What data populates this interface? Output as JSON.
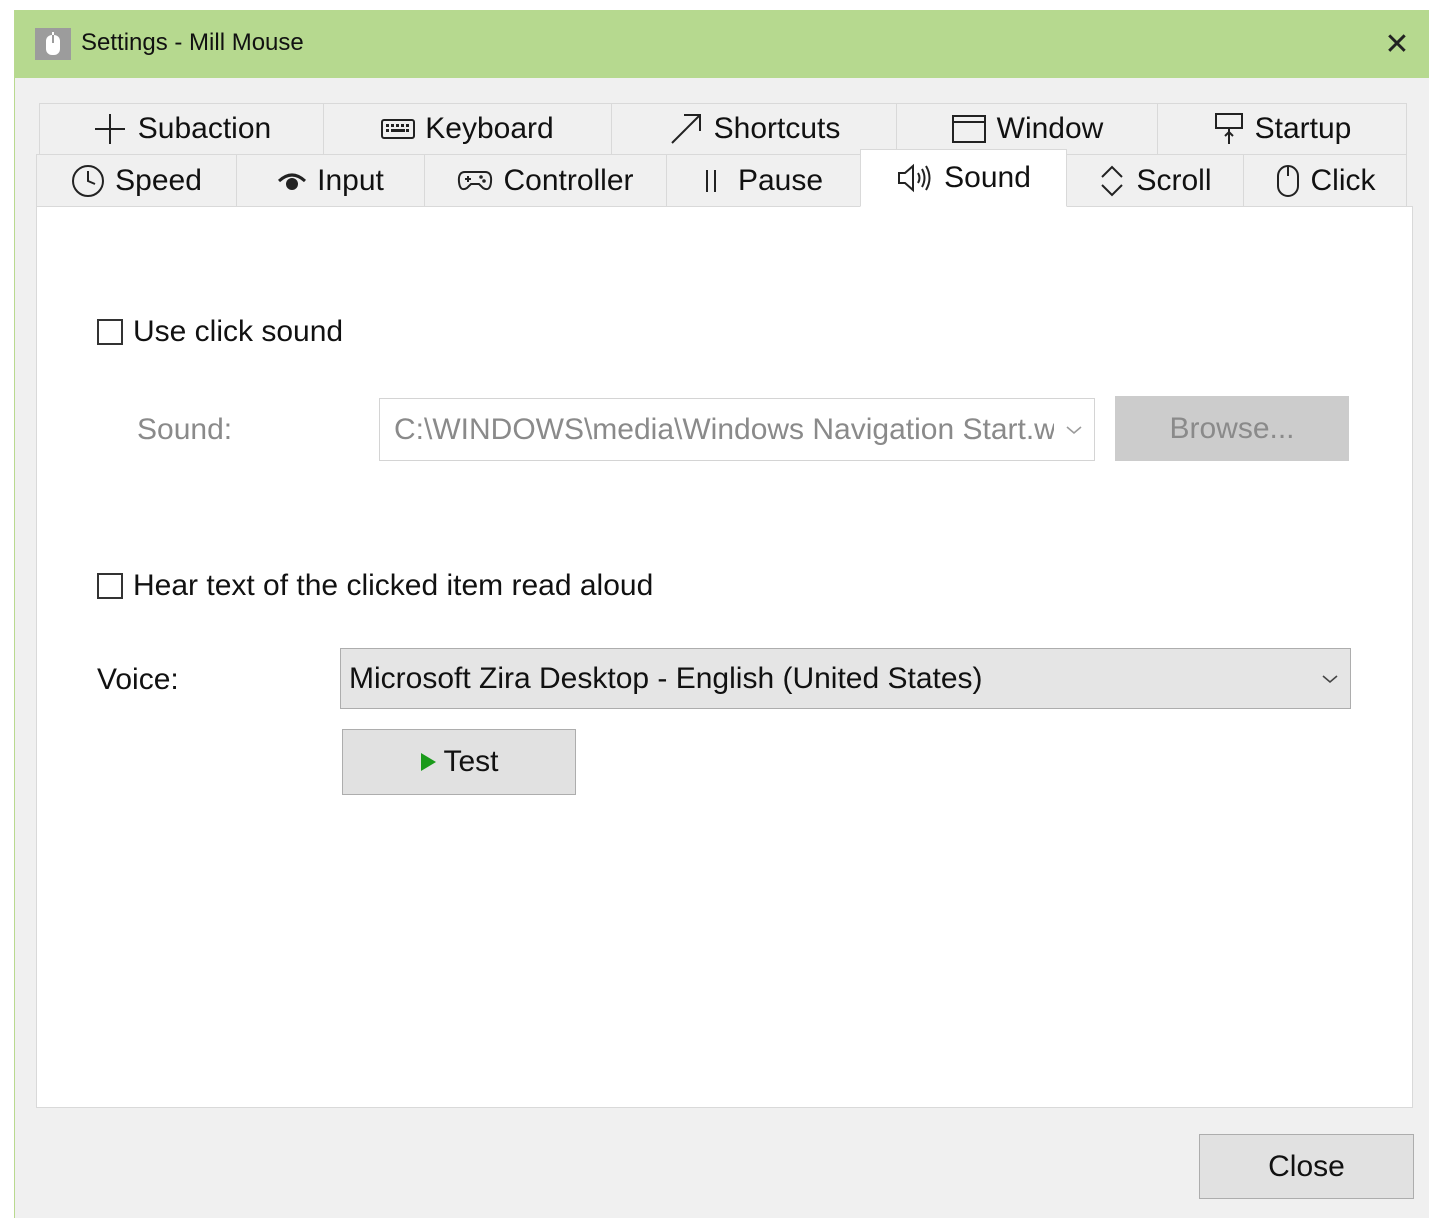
{
  "window": {
    "title": "Settings - Mill Mouse",
    "close_glyph": "✕"
  },
  "tabs_row1": [
    {
      "label": "Subaction",
      "icon": "plus-icon"
    },
    {
      "label": "Keyboard",
      "icon": "keyboard-icon"
    },
    {
      "label": "Shortcuts",
      "icon": "arrow-up-right-icon"
    },
    {
      "label": "Window",
      "icon": "window-icon"
    },
    {
      "label": "Startup",
      "icon": "startup-icon"
    }
  ],
  "tabs_row2": [
    {
      "label": "Speed",
      "icon": "clock-icon"
    },
    {
      "label": "Input",
      "icon": "eye-icon"
    },
    {
      "label": "Controller",
      "icon": "gamepad-icon"
    },
    {
      "label": "Pause",
      "icon": "pause-icon"
    },
    {
      "label": "Sound",
      "icon": "speaker-icon",
      "active": true
    },
    {
      "label": "Scroll",
      "icon": "scroll-icon"
    },
    {
      "label": "Click",
      "icon": "mouse-icon"
    }
  ],
  "sound_tab": {
    "use_click_sound": {
      "label": "Use click sound",
      "checked": false
    },
    "sound_label": "Sound:",
    "sound_value": "C:\\WINDOWS\\media\\Windows Navigation Start.wav",
    "browse_label": "Browse...",
    "read_aloud": {
      "label": "Hear text of the clicked item read aloud",
      "checked": false
    },
    "voice_label": "Voice:",
    "voice_value": "Microsoft Zira Desktop - English (United States)",
    "test_label": "Test"
  },
  "footer": {
    "close_label": "Close"
  },
  "colors": {
    "titlebar": "#b6d98f",
    "play_arrow": "#1a9a1a"
  }
}
